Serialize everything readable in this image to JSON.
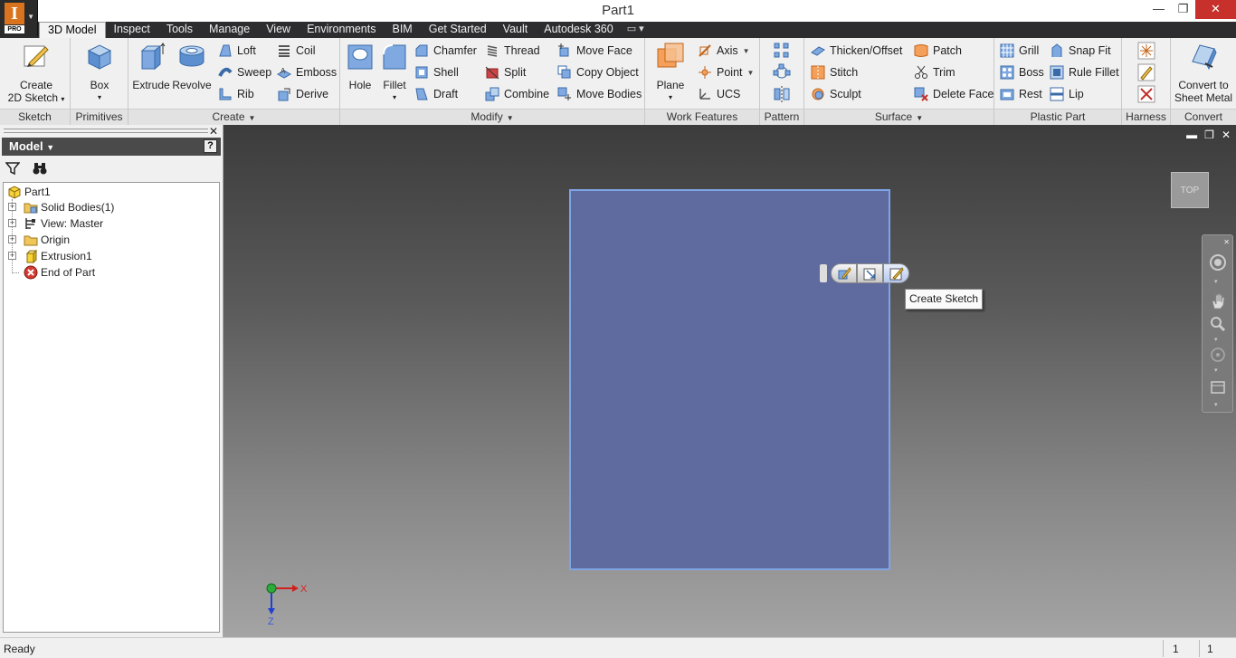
{
  "window": {
    "title": "Part1",
    "app_badge": "I",
    "app_edition": "PRO",
    "controls": {
      "minimize": "—",
      "restore": "❐",
      "close": "✕"
    }
  },
  "tabs": [
    {
      "label": "3D Model",
      "active": true
    },
    {
      "label": "Inspect"
    },
    {
      "label": "Tools"
    },
    {
      "label": "Manage"
    },
    {
      "label": "View"
    },
    {
      "label": "Environments"
    },
    {
      "label": "BIM"
    },
    {
      "label": "Get Started"
    },
    {
      "label": "Vault"
    },
    {
      "label": "Autodesk 360"
    }
  ],
  "ribbon": {
    "sketch": {
      "title": "Sketch",
      "create_line1": "Create",
      "create_line2": "2D Sketch"
    },
    "primitives": {
      "title": "Primitives",
      "box": "Box"
    },
    "create": {
      "title": "Create",
      "extrude": "Extrude",
      "revolve": "Revolve",
      "loft": "Loft",
      "sweep": "Sweep",
      "rib": "Rib",
      "coil": "Coil",
      "emboss": "Emboss",
      "derive": "Derive"
    },
    "modify": {
      "title": "Modify",
      "hole": "Hole",
      "fillet": "Fillet",
      "chamfer": "Chamfer",
      "shell": "Shell",
      "draft": "Draft",
      "thread": "Thread",
      "split": "Split",
      "combine": "Combine",
      "move_face": "Move Face",
      "copy_object": "Copy Object",
      "move_bodies": "Move Bodies"
    },
    "work_features": {
      "title": "Work Features",
      "plane": "Plane",
      "axis": "Axis",
      "point": "Point",
      "ucs": "UCS"
    },
    "pattern": {
      "title": "Pattern"
    },
    "surface": {
      "title": "Surface",
      "thicken_offset": "Thicken/Offset",
      "stitch": "Stitch",
      "sculpt": "Sculpt",
      "patch": "Patch",
      "trim": "Trim",
      "delete_face": "Delete Face"
    },
    "plastic_part": {
      "title": "Plastic Part",
      "grill": "Grill",
      "boss": "Boss",
      "rest": "Rest",
      "snap_fit": "Snap Fit",
      "rule_fillet": "Rule Fillet",
      "lip": "Lip"
    },
    "harness": {
      "title": "Harness"
    },
    "convert": {
      "title": "Convert",
      "line1": "Convert to",
      "line2": "Sheet Metal"
    }
  },
  "browser": {
    "title": "Model",
    "help": "?",
    "tree": [
      {
        "label": "Part1"
      },
      {
        "label": "Solid Bodies(1)"
      },
      {
        "label": "View: Master"
      },
      {
        "label": "Origin"
      },
      {
        "label": "Extrusion1"
      },
      {
        "label": "End of Part"
      }
    ]
  },
  "viewport": {
    "viewcube_face": "TOP",
    "tooltip": "Create Sketch",
    "axis_x": "X",
    "axis_z": "Z",
    "sketch_color": "#5f6b9e"
  },
  "status": {
    "text": "Ready",
    "count1": "1",
    "count2": "1"
  }
}
